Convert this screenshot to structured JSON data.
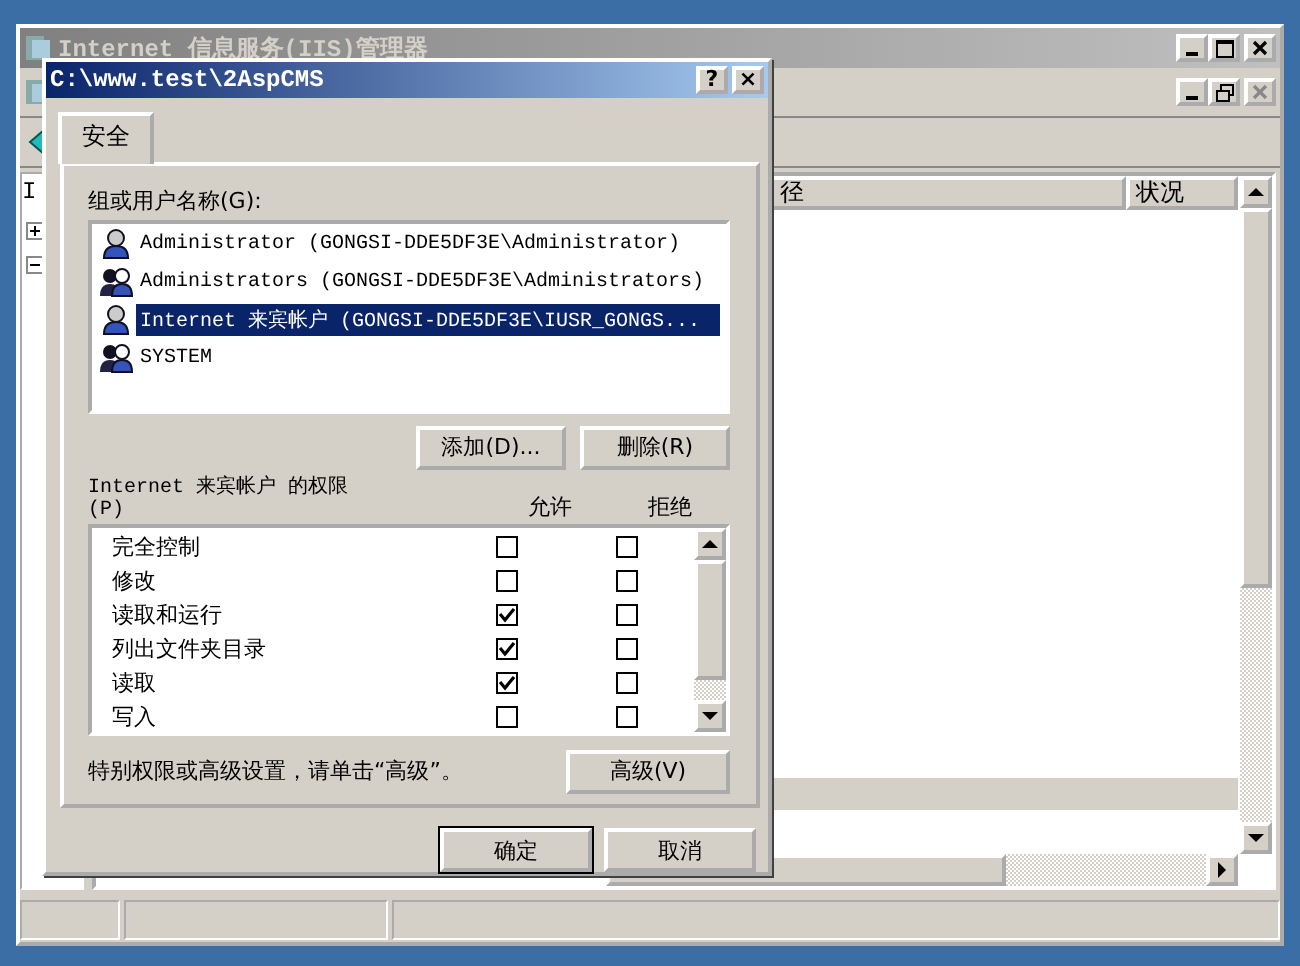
{
  "main_window": {
    "title": "Internet 信息服务(IIS)管理器",
    "tree_stub": "I",
    "columns": [
      "径",
      "状况"
    ]
  },
  "dialog": {
    "title": "C:\\www.test\\2AspCMS",
    "help_button": "?",
    "close_button": "×",
    "tabs": [
      {
        "label": "安全",
        "selected": true
      }
    ],
    "users_label": "组或用户名称(G):",
    "users": [
      {
        "kind": "user",
        "name": "Administrator (GONGSI-DDE5DF3E\\Administrator)",
        "selected": false
      },
      {
        "kind": "group",
        "name": "Administrators (GONGSI-DDE5DF3E\\Administrators)",
        "selected": false
      },
      {
        "kind": "user",
        "name": "Internet 来宾帐户 (GONGSI-DDE5DF3E\\IUSR_GONGS...",
        "selected": true
      },
      {
        "kind": "group",
        "name": "SYSTEM",
        "selected": false
      }
    ],
    "add_button": "添加(D)...",
    "remove_button": "删除(R)",
    "permissions_label": "Internet 来宾帐户 的权限",
    "permissions_mnemonic": "(P)",
    "allow_header": "允许",
    "deny_header": "拒绝",
    "permissions": [
      {
        "name": "完全控制",
        "allow": false,
        "deny": false
      },
      {
        "name": "修改",
        "allow": false,
        "deny": false
      },
      {
        "name": "读取和运行",
        "allow": true,
        "deny": false
      },
      {
        "name": "列出文件夹目录",
        "allow": true,
        "deny": false
      },
      {
        "name": "读取",
        "allow": true,
        "deny": false
      },
      {
        "name": "写入",
        "allow": false,
        "deny": false
      }
    ],
    "advanced_hint": "特别权限或高级设置，请单击“高级”。",
    "advanced_button": "高级(V)",
    "ok_button": "确定",
    "cancel_button": "取消"
  }
}
